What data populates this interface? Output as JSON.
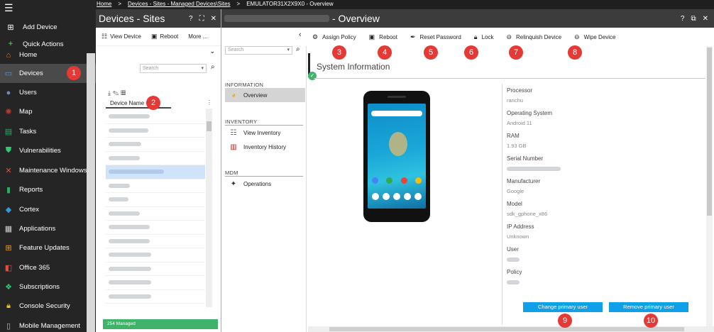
{
  "breadcrumb": {
    "home": "Home",
    "devices_sites": "Devices - Sites - Managed Devices\\Sites",
    "current": "EMULATOR31X2X9X0 - Overview",
    "separator": ">"
  },
  "nav": {
    "add_device": "Add Device",
    "quick_actions": "Quick Actions",
    "items": [
      {
        "label": "Home",
        "icon": "home-icon"
      },
      {
        "label": "Devices",
        "icon": "monitor-icon",
        "active": true
      },
      {
        "label": "Users",
        "icon": "user-icon"
      },
      {
        "label": "Map",
        "icon": "map-icon"
      },
      {
        "label": "Tasks",
        "icon": "tasks-icon"
      },
      {
        "label": "Vulnerabilities",
        "icon": "shield-icon"
      },
      {
        "label": "Maintenance Windows",
        "icon": "tools-icon"
      },
      {
        "label": "Reports",
        "icon": "bar-chart-icon"
      },
      {
        "label": "Cortex",
        "icon": "cortex-icon"
      },
      {
        "label": "Applications",
        "icon": "applications-icon"
      },
      {
        "label": "Feature Updates",
        "icon": "windows-icon"
      },
      {
        "label": "Office 365",
        "icon": "office-icon"
      },
      {
        "label": "Subscriptions",
        "icon": "subscriptions-icon"
      },
      {
        "label": "Console Security",
        "icon": "lock-icon"
      },
      {
        "label": "Mobile Management",
        "icon": "mobile-icon"
      }
    ]
  },
  "callouts": [
    "1",
    "2",
    "3",
    "4",
    "5",
    "6",
    "7",
    "8",
    "9",
    "10"
  ],
  "devices_panel": {
    "title": "Devices - Sites",
    "help": "?",
    "expand": "⛶",
    "close": "✕",
    "toolbar": {
      "view_device": "View Device",
      "reboot": "Reboot",
      "more": "More ..."
    },
    "search_placeholder": "Search",
    "column_header": "Device Name",
    "status": "254 Managed"
  },
  "overview": {
    "title_suffix": "- Overview",
    "help": "?",
    "close": "✕",
    "actions": [
      {
        "label": "Assign Policy",
        "icon": "gear-icon"
      },
      {
        "label": "Reboot",
        "icon": "reboot-icon"
      },
      {
        "label": "Reset Password",
        "icon": "pen-icon"
      },
      {
        "label": "Lock",
        "icon": "lock-icon"
      },
      {
        "label": "Relinquish Device",
        "icon": "block-icon"
      },
      {
        "label": "Wipe Device",
        "icon": "block-icon"
      }
    ],
    "sidebar": {
      "search_placeholder": "Search",
      "sections": {
        "information": "INFORMATION",
        "inventory": "INVENTORY",
        "mdm": "MDM"
      },
      "items": {
        "overview": "Overview",
        "view_inventory": "View Inventory",
        "inventory_history": "Inventory History",
        "operations": "Operations"
      }
    },
    "section_title": "System Information",
    "properties": {
      "processor_label": "Processor",
      "processor_value": "ranchu",
      "os_label": "Operating System",
      "os_value": "Android 11",
      "ram_label": "RAM",
      "ram_value": "1.93 GB",
      "serial_label": "Serial Number",
      "manufacturer_label": "Manufacturer",
      "manufacturer_value": "Google",
      "model_label": "Model",
      "model_value": "sdk_gphone_x86",
      "ip_label": "IP Address",
      "ip_value": "Unknown",
      "user_label": "User",
      "policy_label": "Policy"
    },
    "buttons": {
      "change_primary_user": "Change primary user",
      "remove_primary_user": "Remove primary user"
    }
  }
}
